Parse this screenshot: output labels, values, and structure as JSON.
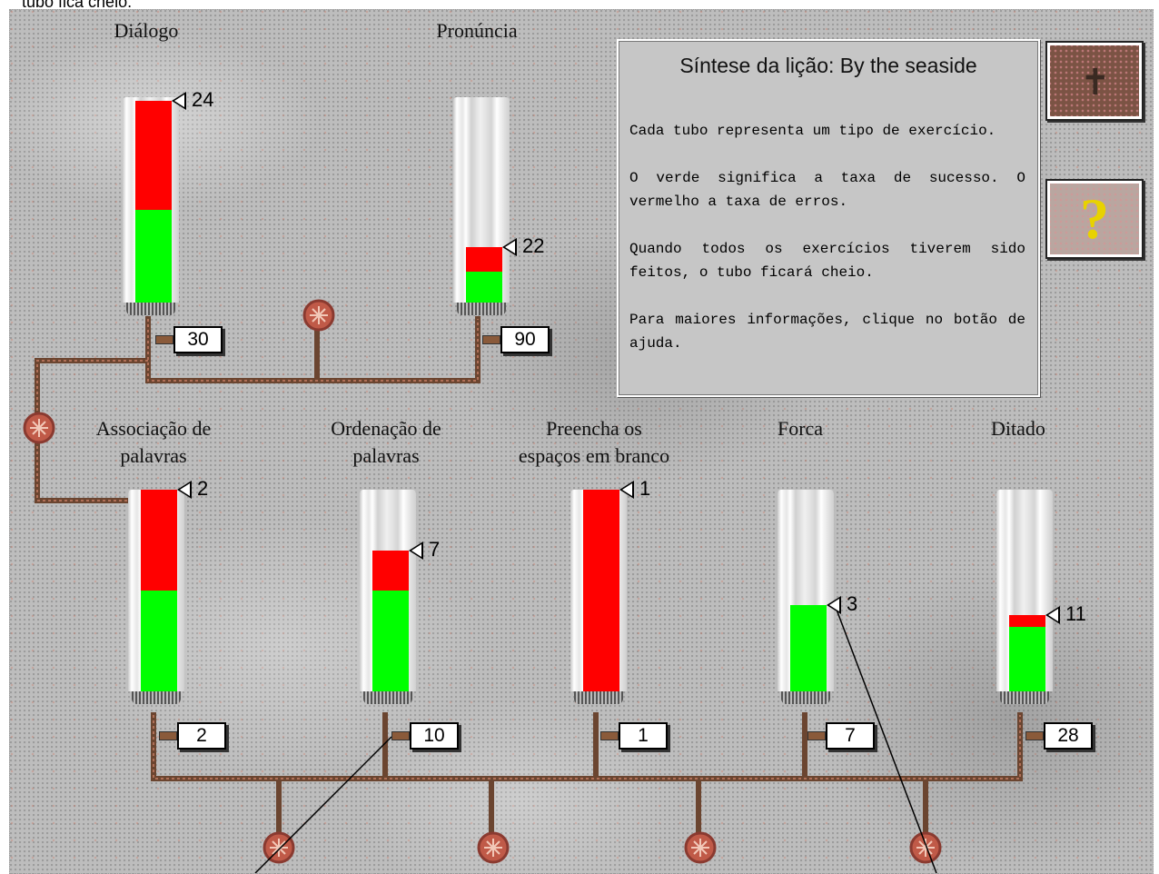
{
  "caption": "tubo fica cheio.",
  "panel": {
    "title": "Síntese da lição: By the seaside",
    "paragraphs": [
      "Cada tubo representa um tipo de exercício.",
      "O verde significa a taxa de sucesso. O vermelho a taxa de erros.",
      "Quando todos os exercícios tiverem sido feitos, o tubo ficará cheio.",
      "Para maiores informações, clique no botão de ajuda."
    ]
  },
  "buttons": {
    "map_icon": "map-icon",
    "help_icon": "question-mark-icon",
    "help_glyph": "?"
  },
  "exercises": [
    {
      "id": "dialogo",
      "label": "Diálogo",
      "marker": "24",
      "count": "30",
      "green": 0.45,
      "red": 0.53
    },
    {
      "id": "pronuncia",
      "label": "Pronúncia",
      "marker": "22",
      "count": "90",
      "green": 0.15,
      "red": 0.12
    },
    {
      "id": "associacao",
      "label": "Associação de\npalavras",
      "marker": "2",
      "count": "2",
      "green": 0.5,
      "red": 0.5
    },
    {
      "id": "ordenacao",
      "label": "Ordenação de\npalavras",
      "marker": "7",
      "count": "10",
      "green": 0.5,
      "red": 0.2
    },
    {
      "id": "preencha",
      "label": "Preencha os\nespaços em branco",
      "marker": "1",
      "count": "1",
      "green": 0.0,
      "red": 1.0
    },
    {
      "id": "forca",
      "label": "Forca",
      "marker": "3",
      "count": "7",
      "green": 0.43,
      "red": 0.0
    },
    {
      "id": "ditado",
      "label": "Ditado",
      "marker": "11",
      "count": "28",
      "green": 0.32,
      "red": 0.06
    }
  ],
  "colors": {
    "success": "#00ff00",
    "error": "#ff0000",
    "pipe": "#8b5a3c",
    "valve": "#c05040"
  }
}
